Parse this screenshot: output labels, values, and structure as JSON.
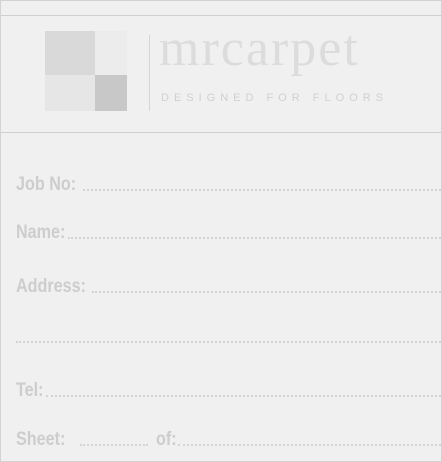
{
  "header": {
    "brand_name": "mrcarpet",
    "tagline": "DESIGNED FOR FLOORS",
    "logo_icon": "checker-squares-logo"
  },
  "form": {
    "job_no_label": "Job No:",
    "name_label": "Name:",
    "address_label": "Address:",
    "tel_label": "Tel:",
    "sheet_label": "Sheet:",
    "of_label": "of:"
  }
}
